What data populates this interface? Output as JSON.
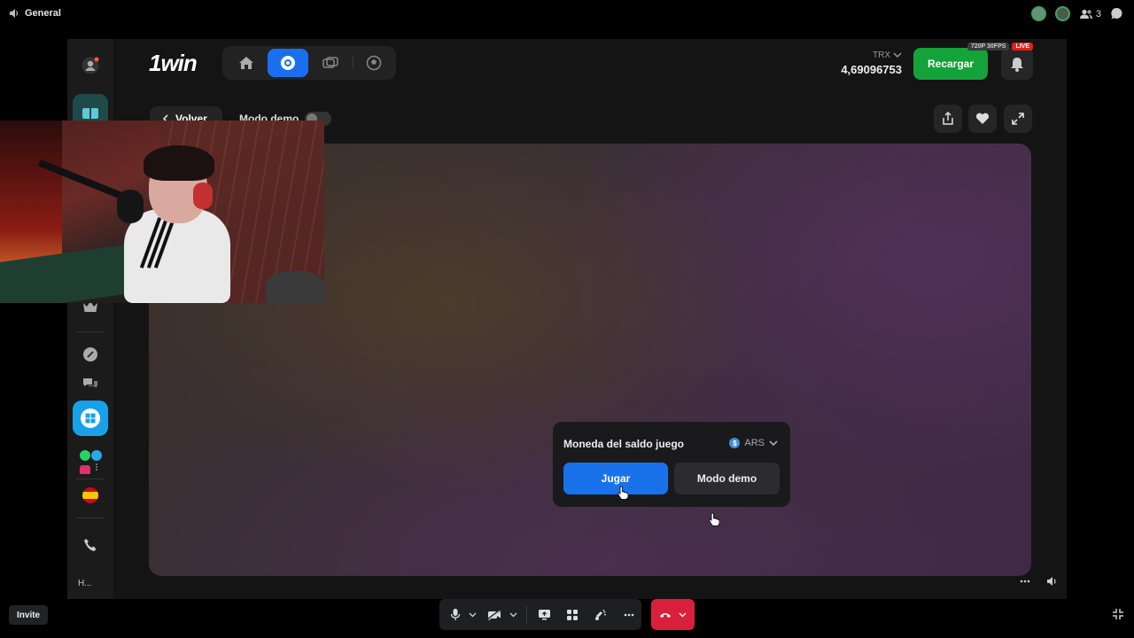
{
  "voice": {
    "channel_name": "General",
    "participants_count": "3",
    "invite_label": "Invite"
  },
  "casino": {
    "logo": "1win",
    "currency_code": "TRX",
    "balance": "4,69096753",
    "topup_label": "Recargar",
    "stream_quality": "720P 30FPS",
    "live_label": "LIVE",
    "back_label": "Volver",
    "demo_label": "Modo demo",
    "sidebar_bottom_label": "H..."
  },
  "modal": {
    "title": "Moneda del saldo juego",
    "currency_symbol": "$",
    "currency": "ARS",
    "play_label": "Jugar",
    "demo_label": "Modo demo"
  },
  "colors": {
    "accent_blue": "#1a72ea",
    "topup_green": "#14a33a",
    "hangup_red": "#d8203b",
    "live_red": "#e02020"
  }
}
